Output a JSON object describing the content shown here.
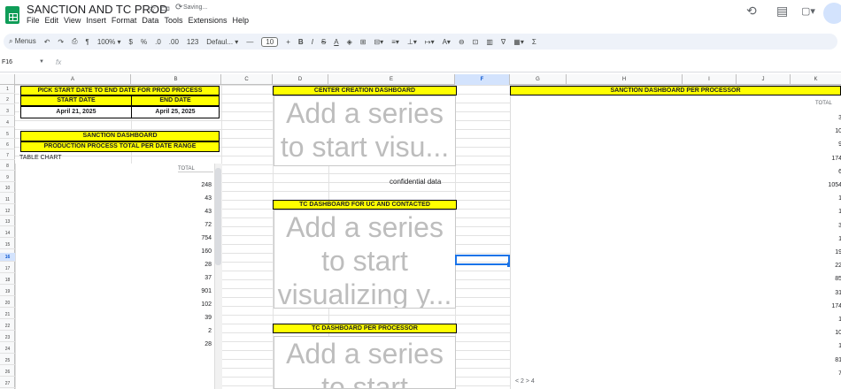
{
  "app": {
    "title": "SANCTION AND TC PROD",
    "saving_text": "Saving..."
  },
  "menu": [
    "File",
    "Edit",
    "View",
    "Insert",
    "Format",
    "Data",
    "Tools",
    "Extensions",
    "Help"
  ],
  "toolbar": {
    "menus_label": "Menus",
    "zoom": "100%",
    "currency": "$",
    "percent": "%",
    "dec_less": ".0",
    "dec_more": ".00",
    "num_fmt": "123",
    "font": "Defaul...",
    "font_size": "10",
    "bold": "B",
    "italic": "I",
    "strike": "S",
    "textcolor": "A"
  },
  "formula_bar": {
    "cell_ref": "F16",
    "fx": "fx"
  },
  "columns": [
    "A",
    "B",
    "C",
    "D",
    "E",
    "F",
    "G",
    "H",
    "I",
    "J",
    "K"
  ],
  "rows": [
    "1",
    "2",
    "3",
    "4",
    "5",
    "6",
    "7",
    "8",
    "9",
    "10",
    "11",
    "12",
    "13",
    "14",
    "15",
    "16",
    "17",
    "18",
    "19",
    "20",
    "21",
    "22",
    "23",
    "24",
    "25",
    "26",
    "27"
  ],
  "cells": {
    "a1": "PICK START DATE TO END DATE FOR PROD PROCESS",
    "a2": "START DATE",
    "b2": "END DATE",
    "a3": "April 21, 2025",
    "b3": "April 25, 2025",
    "a5": "SANCTION DASHBOARD",
    "a6": "PRODUCTION PROCESS TOTAL PER DATE RANGE",
    "a7": "TABLE CHART",
    "d1": "CENTER CREATION DASHBOARD",
    "e9": "confidential data",
    "d11": "TC DASHBOARD FOR UC AND CONTACTED",
    "d22": "TC DASHBOARD PER PROCESSOR",
    "g1": "SANCTION DASHBOARD PER PROCESSOR"
  },
  "placeholders": {
    "center": "Add a series to start visu...",
    "tc": "Add a series to start visualizing y...",
    "tcproc": "Add a series to start"
  },
  "table_chart": {
    "header": "TOTAL",
    "values": [
      "248",
      "43",
      "43",
      "72",
      "754",
      "160",
      "28",
      "37",
      "901",
      "102",
      "39",
      "2",
      "28"
    ]
  },
  "proc_chart": {
    "header": "TOTAL",
    "values": [
      "3",
      "10",
      "9",
      "174",
      "6",
      "1054",
      "1",
      "1",
      "3",
      "1",
      "19",
      "22",
      "85",
      "31",
      "174",
      "1",
      "10",
      "1",
      "81",
      "7"
    ],
    "pager": "< 2 > 4"
  }
}
